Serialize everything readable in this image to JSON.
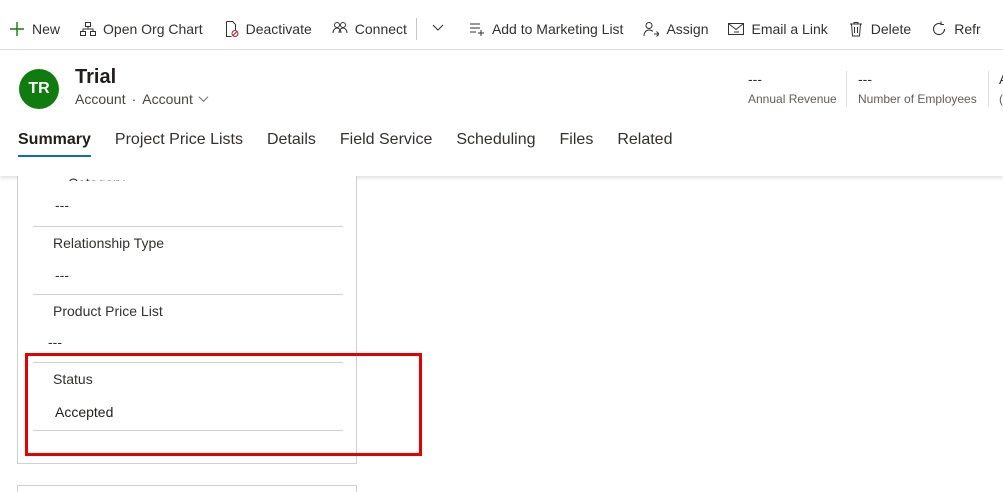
{
  "command_bar": {
    "items": [
      {
        "label": "New",
        "icon": "plus-icon"
      },
      {
        "label": "Open Org Chart",
        "icon": "org-chart-icon"
      },
      {
        "label": "Deactivate",
        "icon": "deactivate-icon"
      },
      {
        "label": "Connect",
        "icon": "connect-icon"
      }
    ],
    "items2": [
      {
        "label": "Add to Marketing List",
        "icon": "add-list-icon"
      },
      {
        "label": "Assign",
        "icon": "assign-icon"
      },
      {
        "label": "Email a Link",
        "icon": "email-link-icon"
      },
      {
        "label": "Delete",
        "icon": "delete-icon"
      },
      {
        "label": "Refr",
        "icon": "refresh-icon"
      }
    ]
  },
  "record": {
    "initials": "TR",
    "avatar_color": "#107c10",
    "title": "Trial",
    "entity": "Account",
    "form": "Account"
  },
  "header_fields": [
    {
      "value": "---",
      "label": "Annual Revenue"
    },
    {
      "value": "---",
      "label": "Number of Employees"
    },
    {
      "value": "A",
      "label": "("
    }
  ],
  "tabs": [
    "Summary",
    "Project Price Lists",
    "Details",
    "Field Service",
    "Scheduling",
    "Files",
    "Related"
  ],
  "fields": {
    "cut_label": "Category",
    "cut_value": "---",
    "relationship_type": {
      "label": "Relationship Type",
      "value": "---"
    },
    "product_price_list": {
      "label": "Product Price List",
      "value": "---"
    },
    "status": {
      "label": "Status",
      "value": "Accepted"
    }
  },
  "colors": {
    "accent": "#0f6cbd",
    "highlight": "#e00000"
  }
}
